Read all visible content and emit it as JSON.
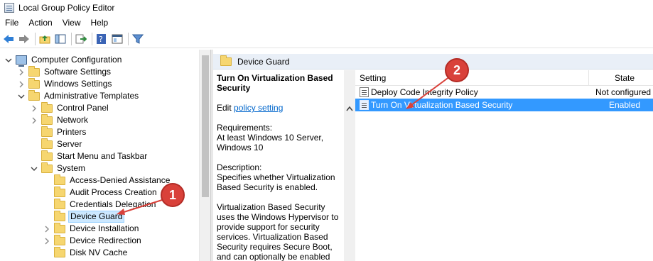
{
  "window": {
    "title": "Local Group Policy Editor"
  },
  "menu": [
    "File",
    "Action",
    "View",
    "Help"
  ],
  "tree": {
    "items": [
      {
        "label": "Computer Configuration",
        "expander": "expanded",
        "icon": "computer-icon"
      },
      {
        "label": "Software Settings",
        "expander": "collapsed",
        "icon": "folder-icon"
      },
      {
        "label": "Windows Settings",
        "expander": "collapsed",
        "icon": "folder-icon"
      },
      {
        "label": "Administrative Templates",
        "expander": "expanded",
        "icon": "folder-icon"
      },
      {
        "label": "Control Panel",
        "expander": "collapsed",
        "icon": "folder-icon"
      },
      {
        "label": "Network",
        "expander": "collapsed",
        "icon": "folder-icon"
      },
      {
        "label": "Printers",
        "expander": "none",
        "icon": "folder-icon"
      },
      {
        "label": "Server",
        "expander": "none",
        "icon": "folder-icon"
      },
      {
        "label": "Start Menu and Taskbar",
        "expander": "none",
        "icon": "folder-icon"
      },
      {
        "label": "System",
        "expander": "expanded",
        "icon": "folder-icon"
      },
      {
        "label": "Access-Denied Assistance",
        "expander": "none",
        "icon": "folder-icon"
      },
      {
        "label": "Audit Process Creation",
        "expander": "none",
        "icon": "folder-icon"
      },
      {
        "label": "Credentials Delegation",
        "expander": "none",
        "icon": "folder-icon"
      },
      {
        "label": "Device Guard",
        "expander": "none",
        "icon": "folder-icon",
        "selected": true
      },
      {
        "label": "Device Installation",
        "expander": "collapsed",
        "icon": "folder-icon"
      },
      {
        "label": "Device Redirection",
        "expander": "collapsed",
        "icon": "folder-icon"
      },
      {
        "label": "Disk NV Cache",
        "expander": "none",
        "icon": "folder-icon"
      }
    ]
  },
  "right": {
    "header": "Device Guard",
    "description": {
      "title": "Turn On Virtualization Based Security",
      "edit_prefix": "Edit",
      "edit_link": "policy setting",
      "requirements_label": "Requirements:",
      "requirements_text": "At least Windows 10 Server, Windows 10",
      "description_label": "Description:",
      "description_text": "Specifies whether Virtualization Based Security is enabled.",
      "body_text": "Virtualization Based Security uses the Windows Hypervisor to provide support for security services.  Virtualization Based Security requires Secure Boot, and can optionally be enabled with the"
    },
    "columns": {
      "setting": "Setting",
      "state": "State"
    },
    "rows": [
      {
        "name": "Deploy Code Integrity Policy",
        "state": "Not configured",
        "selected": false
      },
      {
        "name": "Turn On Virtualization Based Security",
        "state": "Enabled",
        "selected": true
      }
    ]
  },
  "annotations": {
    "badge1": "1",
    "badge2": "2",
    "accent": "#d9413a"
  }
}
